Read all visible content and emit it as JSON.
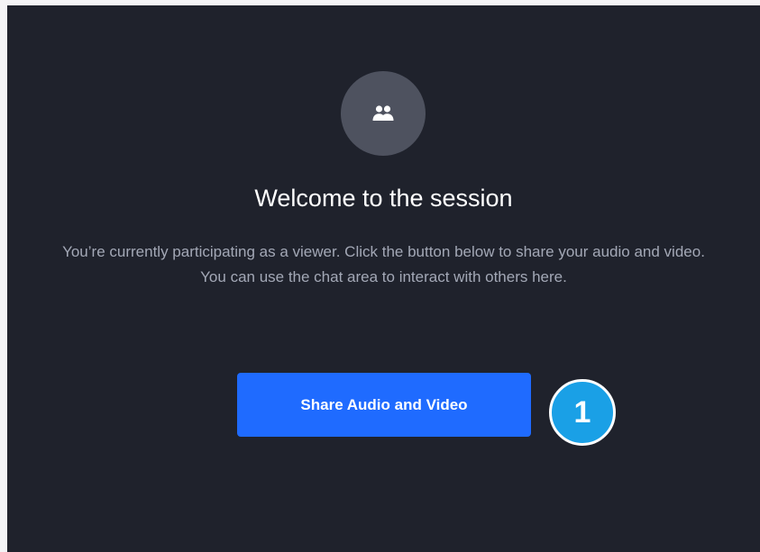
{
  "colors": {
    "page_background": "#f4f4f6",
    "panel_background": "#1f222c",
    "avatar_background": "#4e525f",
    "title_text": "#ffffff",
    "description_text": "#a3a8b6",
    "primary_button": "#1f6bff",
    "step_badge": "#1aa0e6"
  },
  "session": {
    "icon": "people-icon",
    "title": "Welcome to the session",
    "description": "You’re currently participating as a viewer. Click the button below to share your audio and video. You can use the chat area to interact with others here.",
    "share_button_label": "Share Audio and Video"
  },
  "annotation": {
    "step_number": "1"
  }
}
